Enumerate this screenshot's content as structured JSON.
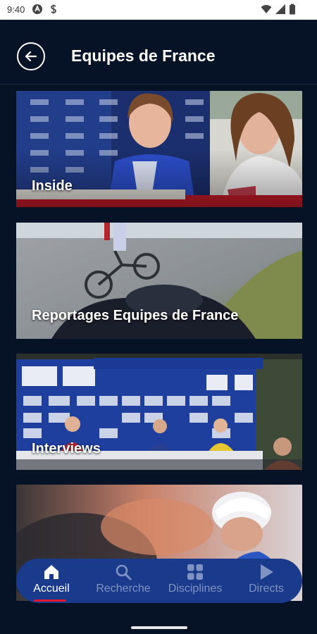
{
  "status_bar": {
    "time": "9:40",
    "icons": [
      "nfc-a-icon",
      "s-app-icon",
      "wifi-icon",
      "signal-icon",
      "battery-icon"
    ]
  },
  "header": {
    "back_icon": "back-arrow-icon",
    "title": "Equipes de France"
  },
  "cards": [
    {
      "label": "Inside"
    },
    {
      "label": "Reportages Equipes de France"
    },
    {
      "label": "Interviews"
    },
    {
      "label": ""
    }
  ],
  "bottom_nav": {
    "items": [
      {
        "label": "Accueil",
        "icon": "home-icon",
        "active": true
      },
      {
        "label": "Recherche",
        "icon": "search-icon",
        "active": false
      },
      {
        "label": "Disciplines",
        "icon": "grid-icon",
        "active": false
      },
      {
        "label": "Directs",
        "icon": "play-icon",
        "active": false
      }
    ]
  },
  "colors": {
    "background": "#061327",
    "nav_background": "#1a3a8c",
    "active_underline": "#e2162e",
    "inactive_label": "#7f93c4"
  }
}
